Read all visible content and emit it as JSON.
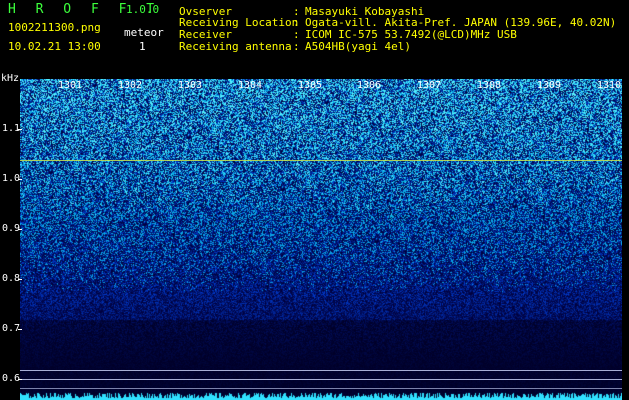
{
  "app": {
    "title": "H R O F F T",
    "version": "1.0.0"
  },
  "file": {
    "name": "1002211300.png",
    "datetime": "10.02.21 13:00"
  },
  "counter": {
    "label": "meteor",
    "value": "1"
  },
  "info": {
    "rows": [
      {
        "label": "Ovserver",
        "value": "Masayuki Kobayashi"
      },
      {
        "label": "Receiving Location",
        "value": "Ogata-vill. Akita-Pref. JAPAN (139.96E, 40.02N)"
      },
      {
        "label": "Receiver",
        "value": "ICOM IC-575 53.7492(@LCD)MHz USB"
      },
      {
        "label": "Receiving antenna",
        "value": "A504HB(yagi 4el)"
      }
    ]
  },
  "axis": {
    "unit": "kHz",
    "frequency_ticks": [
      "1.1",
      "1.0",
      "0.9",
      "0.8",
      "0.7",
      "0.6"
    ],
    "time_ticks": [
      "1301",
      "1302",
      "1303",
      "1304",
      "1305",
      "1306",
      "1307",
      "1308",
      "1309",
      "1310"
    ]
  },
  "colors": {
    "carrier": "#c8e650",
    "noise_bright": "#32c8ff",
    "background": "#000000"
  }
}
